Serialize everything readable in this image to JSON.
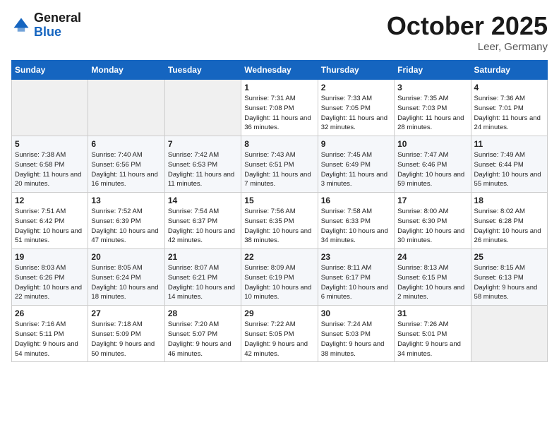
{
  "logo": {
    "line1": "General",
    "line2": "Blue"
  },
  "title": "October 2025",
  "location": "Leer, Germany",
  "headers": [
    "Sunday",
    "Monday",
    "Tuesday",
    "Wednesday",
    "Thursday",
    "Friday",
    "Saturday"
  ],
  "weeks": [
    [
      {
        "day": "",
        "sunrise": "",
        "sunset": "",
        "daylight": ""
      },
      {
        "day": "",
        "sunrise": "",
        "sunset": "",
        "daylight": ""
      },
      {
        "day": "",
        "sunrise": "",
        "sunset": "",
        "daylight": ""
      },
      {
        "day": "1",
        "sunrise": "Sunrise: 7:31 AM",
        "sunset": "Sunset: 7:08 PM",
        "daylight": "Daylight: 11 hours and 36 minutes."
      },
      {
        "day": "2",
        "sunrise": "Sunrise: 7:33 AM",
        "sunset": "Sunset: 7:05 PM",
        "daylight": "Daylight: 11 hours and 32 minutes."
      },
      {
        "day": "3",
        "sunrise": "Sunrise: 7:35 AM",
        "sunset": "Sunset: 7:03 PM",
        "daylight": "Daylight: 11 hours and 28 minutes."
      },
      {
        "day": "4",
        "sunrise": "Sunrise: 7:36 AM",
        "sunset": "Sunset: 7:01 PM",
        "daylight": "Daylight: 11 hours and 24 minutes."
      }
    ],
    [
      {
        "day": "5",
        "sunrise": "Sunrise: 7:38 AM",
        "sunset": "Sunset: 6:58 PM",
        "daylight": "Daylight: 11 hours and 20 minutes."
      },
      {
        "day": "6",
        "sunrise": "Sunrise: 7:40 AM",
        "sunset": "Sunset: 6:56 PM",
        "daylight": "Daylight: 11 hours and 16 minutes."
      },
      {
        "day": "7",
        "sunrise": "Sunrise: 7:42 AM",
        "sunset": "Sunset: 6:53 PM",
        "daylight": "Daylight: 11 hours and 11 minutes."
      },
      {
        "day": "8",
        "sunrise": "Sunrise: 7:43 AM",
        "sunset": "Sunset: 6:51 PM",
        "daylight": "Daylight: 11 hours and 7 minutes."
      },
      {
        "day": "9",
        "sunrise": "Sunrise: 7:45 AM",
        "sunset": "Sunset: 6:49 PM",
        "daylight": "Daylight: 11 hours and 3 minutes."
      },
      {
        "day": "10",
        "sunrise": "Sunrise: 7:47 AM",
        "sunset": "Sunset: 6:46 PM",
        "daylight": "Daylight: 10 hours and 59 minutes."
      },
      {
        "day": "11",
        "sunrise": "Sunrise: 7:49 AM",
        "sunset": "Sunset: 6:44 PM",
        "daylight": "Daylight: 10 hours and 55 minutes."
      }
    ],
    [
      {
        "day": "12",
        "sunrise": "Sunrise: 7:51 AM",
        "sunset": "Sunset: 6:42 PM",
        "daylight": "Daylight: 10 hours and 51 minutes."
      },
      {
        "day": "13",
        "sunrise": "Sunrise: 7:52 AM",
        "sunset": "Sunset: 6:39 PM",
        "daylight": "Daylight: 10 hours and 47 minutes."
      },
      {
        "day": "14",
        "sunrise": "Sunrise: 7:54 AM",
        "sunset": "Sunset: 6:37 PM",
        "daylight": "Daylight: 10 hours and 42 minutes."
      },
      {
        "day": "15",
        "sunrise": "Sunrise: 7:56 AM",
        "sunset": "Sunset: 6:35 PM",
        "daylight": "Daylight: 10 hours and 38 minutes."
      },
      {
        "day": "16",
        "sunrise": "Sunrise: 7:58 AM",
        "sunset": "Sunset: 6:33 PM",
        "daylight": "Daylight: 10 hours and 34 minutes."
      },
      {
        "day": "17",
        "sunrise": "Sunrise: 8:00 AM",
        "sunset": "Sunset: 6:30 PM",
        "daylight": "Daylight: 10 hours and 30 minutes."
      },
      {
        "day": "18",
        "sunrise": "Sunrise: 8:02 AM",
        "sunset": "Sunset: 6:28 PM",
        "daylight": "Daylight: 10 hours and 26 minutes."
      }
    ],
    [
      {
        "day": "19",
        "sunrise": "Sunrise: 8:03 AM",
        "sunset": "Sunset: 6:26 PM",
        "daylight": "Daylight: 10 hours and 22 minutes."
      },
      {
        "day": "20",
        "sunrise": "Sunrise: 8:05 AM",
        "sunset": "Sunset: 6:24 PM",
        "daylight": "Daylight: 10 hours and 18 minutes."
      },
      {
        "day": "21",
        "sunrise": "Sunrise: 8:07 AM",
        "sunset": "Sunset: 6:21 PM",
        "daylight": "Daylight: 10 hours and 14 minutes."
      },
      {
        "day": "22",
        "sunrise": "Sunrise: 8:09 AM",
        "sunset": "Sunset: 6:19 PM",
        "daylight": "Daylight: 10 hours and 10 minutes."
      },
      {
        "day": "23",
        "sunrise": "Sunrise: 8:11 AM",
        "sunset": "Sunset: 6:17 PM",
        "daylight": "Daylight: 10 hours and 6 minutes."
      },
      {
        "day": "24",
        "sunrise": "Sunrise: 8:13 AM",
        "sunset": "Sunset: 6:15 PM",
        "daylight": "Daylight: 10 hours and 2 minutes."
      },
      {
        "day": "25",
        "sunrise": "Sunrise: 8:15 AM",
        "sunset": "Sunset: 6:13 PM",
        "daylight": "Daylight: 9 hours and 58 minutes."
      }
    ],
    [
      {
        "day": "26",
        "sunrise": "Sunrise: 7:16 AM",
        "sunset": "Sunset: 5:11 PM",
        "daylight": "Daylight: 9 hours and 54 minutes."
      },
      {
        "day": "27",
        "sunrise": "Sunrise: 7:18 AM",
        "sunset": "Sunset: 5:09 PM",
        "daylight": "Daylight: 9 hours and 50 minutes."
      },
      {
        "day": "28",
        "sunrise": "Sunrise: 7:20 AM",
        "sunset": "Sunset: 5:07 PM",
        "daylight": "Daylight: 9 hours and 46 minutes."
      },
      {
        "day": "29",
        "sunrise": "Sunrise: 7:22 AM",
        "sunset": "Sunset: 5:05 PM",
        "daylight": "Daylight: 9 hours and 42 minutes."
      },
      {
        "day": "30",
        "sunrise": "Sunrise: 7:24 AM",
        "sunset": "Sunset: 5:03 PM",
        "daylight": "Daylight: 9 hours and 38 minutes."
      },
      {
        "day": "31",
        "sunrise": "Sunrise: 7:26 AM",
        "sunset": "Sunset: 5:01 PM",
        "daylight": "Daylight: 9 hours and 34 minutes."
      },
      {
        "day": "",
        "sunrise": "",
        "sunset": "",
        "daylight": ""
      }
    ]
  ]
}
